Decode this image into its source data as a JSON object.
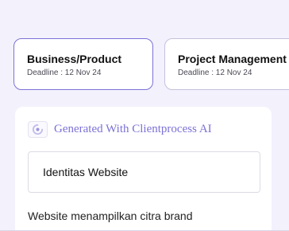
{
  "tasks": [
    {
      "title": "Business/Product",
      "deadline": "Deadline : 12 Nov 24"
    },
    {
      "title": "Project Management",
      "deadline": "Deadline : 12 Nov 24"
    }
  ],
  "generator": {
    "icon": "ai-sparkle-icon",
    "label": "Generated With Clientprocess AI"
  },
  "website_identity": {
    "value": "Identitas Website"
  },
  "description": {
    "text": "Website menampilkan citra brand"
  },
  "colors": {
    "accent": "#7b72d6",
    "background": "#f3f1fc",
    "card": "#ffffff"
  }
}
